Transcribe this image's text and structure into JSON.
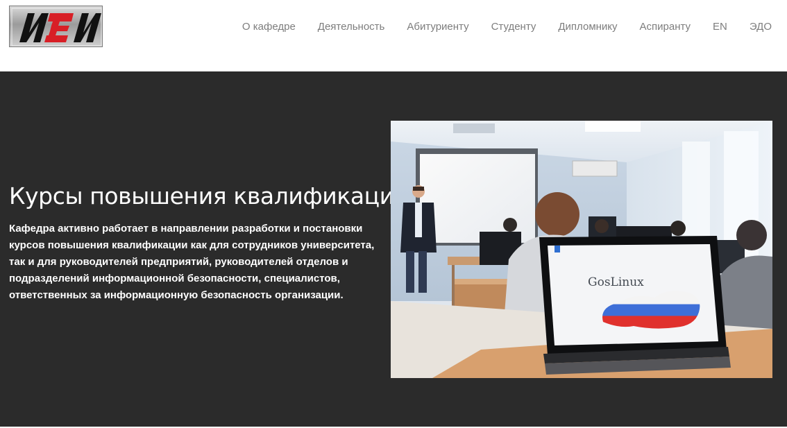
{
  "logo": {
    "text": "ИЗИ"
  },
  "nav": {
    "items": [
      {
        "label": "О кафедре"
      },
      {
        "label": "Деятельность"
      },
      {
        "label": "Абитуриенту"
      },
      {
        "label": "Студенту"
      },
      {
        "label": "Дипломнику"
      },
      {
        "label": "Аспиранту"
      },
      {
        "label": "EN"
      },
      {
        "label": "ЭДО"
      }
    ]
  },
  "hero": {
    "title": "Курсы повышения квалификации",
    "description": "Кафедра активно работает в направлении разработки и постановки курсов повышения квалификации как для сотрудников университета, так и для руководителей предприятий, руководителей отделов и подразделений информационной безопасности, специалистов, ответственных за информационную безопасность организации.",
    "image": {
      "screen_text": "GosLinux"
    }
  },
  "colors": {
    "hero_background": "#2b2b2b",
    "nav_text": "#7d7d7d",
    "logo_accent": "#d81f26"
  }
}
